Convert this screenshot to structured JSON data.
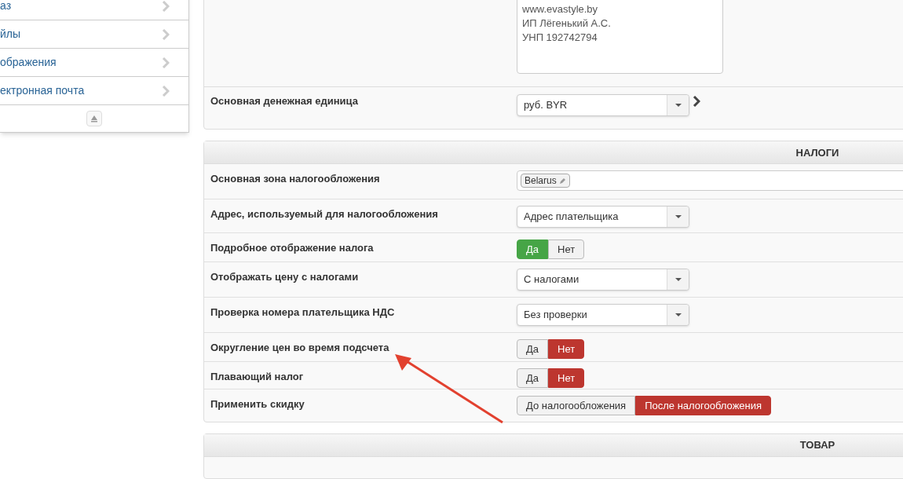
{
  "sidebar": {
    "items": [
      {
        "label": "аз"
      },
      {
        "label": "йлы"
      },
      {
        "label": "ображения"
      },
      {
        "label": "ектронная почта"
      }
    ]
  },
  "store_panel": {
    "address_lines": [
      "www.evastyle.by",
      "ИП Лёгенький А.С.",
      "УНП 192742794"
    ],
    "currency": {
      "label": "Основная денежная единица",
      "value": "руб. BYR"
    }
  },
  "taxes_panel": {
    "title": "НАЛОГИ",
    "rows": [
      {
        "kind": "tags",
        "label": "Основная зона налогообложения",
        "tags": [
          "Belarus"
        ]
      },
      {
        "kind": "select",
        "label": "Адрес, используемый для налогообложения",
        "value": "Адрес плательщика"
      },
      {
        "kind": "toggle",
        "label": "Подробное отображение налога",
        "color": "#46a546",
        "options": [
          {
            "label": "Да",
            "selected": true
          },
          {
            "label": "Нет",
            "selected": false
          }
        ]
      },
      {
        "kind": "select",
        "label": "Отображать цену с налогами",
        "value": "С налогами"
      },
      {
        "kind": "select",
        "label": "Проверка номера плательщика НДС",
        "value": "Без проверки"
      },
      {
        "kind": "toggle",
        "label": "Округление цен во время подсчета",
        "color": "#bd362f",
        "options": [
          {
            "label": "Да",
            "selected": false
          },
          {
            "label": "Нет",
            "selected": true
          }
        ]
      },
      {
        "kind": "toggle",
        "label": "Плавающий налог",
        "color": "#bd362f",
        "options": [
          {
            "label": "Да",
            "selected": false
          },
          {
            "label": "Нет",
            "selected": true
          }
        ]
      },
      {
        "kind": "toggle",
        "label": "Применить скидку",
        "color": "#bd362f",
        "options": [
          {
            "label": "До налогообложения",
            "selected": false
          },
          {
            "label": "После налогообложения",
            "selected": true
          }
        ]
      }
    ]
  },
  "product_panel": {
    "title": "ТОВАР"
  }
}
